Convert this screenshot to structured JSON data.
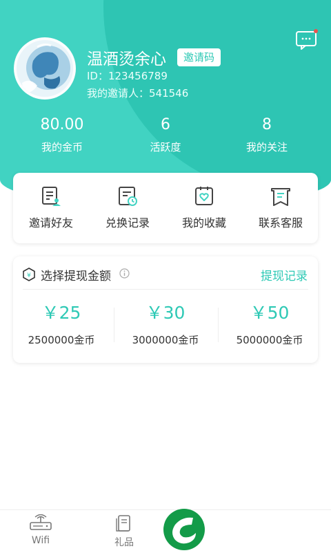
{
  "user": {
    "name": "温酒烫余心",
    "invite_button": "邀请码",
    "id_text": "ID：123456789",
    "inviter_text": "我的邀请人：541546"
  },
  "stats": [
    {
      "value": "80.00",
      "label": "我的金币"
    },
    {
      "value": "6",
      "label": "活跃度"
    },
    {
      "value": "8",
      "label": "我的关注"
    }
  ],
  "quick_actions": [
    {
      "label": "邀请好友",
      "icon": "invite-friends-icon"
    },
    {
      "label": "兑换记录",
      "icon": "exchange-record-icon"
    },
    {
      "label": "我的收藏",
      "icon": "favorites-icon"
    },
    {
      "label": "联系客服",
      "icon": "customer-service-icon"
    }
  ],
  "withdraw": {
    "title": "选择提现金额",
    "record_link": "提现记录",
    "options": [
      {
        "price": "￥25",
        "coins": "2500000金币"
      },
      {
        "price": "￥30",
        "coins": "3000000金币"
      },
      {
        "price": "￥50",
        "coins": "5000000金币"
      }
    ]
  },
  "tabbar": {
    "tabs": [
      {
        "label": "Wifi",
        "icon": "router-icon"
      },
      {
        "label": "礼品",
        "icon": "gift-icon"
      }
    ],
    "center_icon": "leaf-logo-icon"
  },
  "colors": {
    "primary": "#41d3c2",
    "accent_text": "#2ec9b5",
    "notification_dot": "#e8534d"
  }
}
